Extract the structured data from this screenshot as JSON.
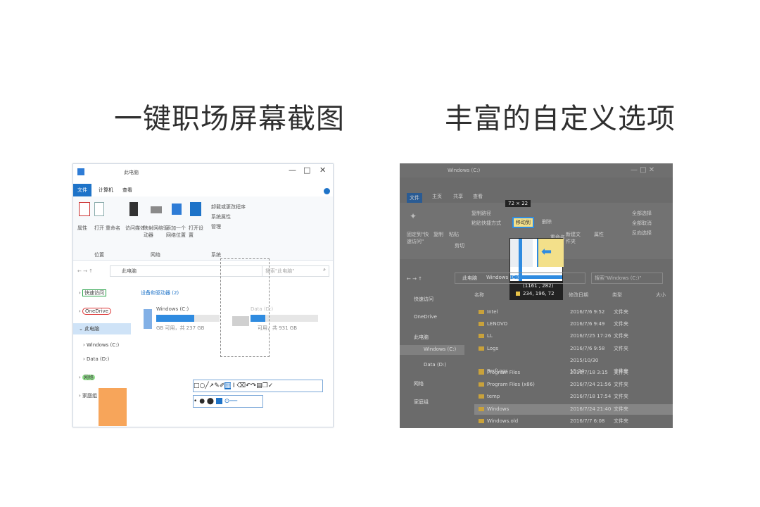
{
  "headings": {
    "left": "一键职场屏幕截图",
    "right": "丰富的自定义选项"
  },
  "left_shot": {
    "window_title": "此电脑",
    "tabs": [
      "文件",
      "计算机",
      "查看"
    ],
    "ribbon": {
      "groups": [
        "位置",
        "网络",
        "系统"
      ],
      "buttons": [
        "属性",
        "打开",
        "重命名",
        "访问媒体",
        "映射网络驱动器",
        "添加一个网络位置",
        "打开设置"
      ],
      "links": [
        "卸载或更改程序",
        "系统属性",
        "管理"
      ]
    },
    "address": "此电脑",
    "search_placeholder": "搜索\"此电脑\"",
    "sidebar": [
      "快速访问",
      "OneDrive",
      "此电脑",
      "Windows (C:)",
      "Data (D:)",
      "网络",
      "家庭组"
    ],
    "section_title": "设备和驱动器 (2)",
    "drives": [
      {
        "name": "Windows (C:)",
        "free": "GB 可用，共 237 GB"
      },
      {
        "name": "Data (D:)",
        "free": "可用，共 931 GB"
      }
    ],
    "highlight_color": "#f7a55a",
    "accent": "#1e73c8"
  },
  "right_shot": {
    "window_title": "Windows (C:)",
    "tabs": [
      "文件",
      "主页",
      "共享",
      "查看"
    ],
    "ribbon_items": [
      "固定到\"快速访问\"",
      "复制",
      "粘贴",
      "复制路径",
      "粘贴快捷方式",
      "剪切",
      "移动到",
      "删除",
      "重命名",
      "新建文件夹",
      "属性",
      "全部选择",
      "全部取消",
      "反向选择"
    ],
    "magnifier": {
      "size": "72 × 22",
      "pos": "(1161 , 282)",
      "rgb": "234, 196, 72"
    },
    "address": [
      "此电脑",
      "Windows (C:)"
    ],
    "search_placeholder": "搜索\"Windows (C:)\"",
    "columns": [
      "名称",
      "修改日期",
      "类型",
      "大小"
    ],
    "sidebar": [
      "快速访问",
      "OneDrive",
      "此电脑",
      "Windows (C:)",
      "Data (D:)",
      "网络",
      "家庭组"
    ],
    "rows": [
      {
        "name": "Intel",
        "date": "2016/7/6 9:52",
        "type": "文件夹"
      },
      {
        "name": "LENOVO",
        "date": "2016/7/6 9:49",
        "type": "文件夹"
      },
      {
        "name": "LL",
        "date": "2016/7/25 17:26",
        "type": "文件夹"
      },
      {
        "name": "Logs",
        "date": "2016/7/6 9:58",
        "type": "文件夹"
      },
      {
        "name": "PerfLogs",
        "date": "2015/10/30 15:24",
        "type": "文件夹"
      },
      {
        "name": "Program Files",
        "date": "2016/7/18 3:15",
        "type": "文件夹"
      },
      {
        "name": "Program Files (x86)",
        "date": "2016/7/24 21:56",
        "type": "文件夹"
      },
      {
        "name": "temp",
        "date": "2016/7/18 17:54",
        "type": "文件夹"
      },
      {
        "name": "Windows",
        "date": "2016/7/24 21:40",
        "type": "文件夹"
      },
      {
        "name": "Windows.old",
        "date": "2016/7/7 6:08",
        "type": "文件夹"
      }
    ]
  }
}
